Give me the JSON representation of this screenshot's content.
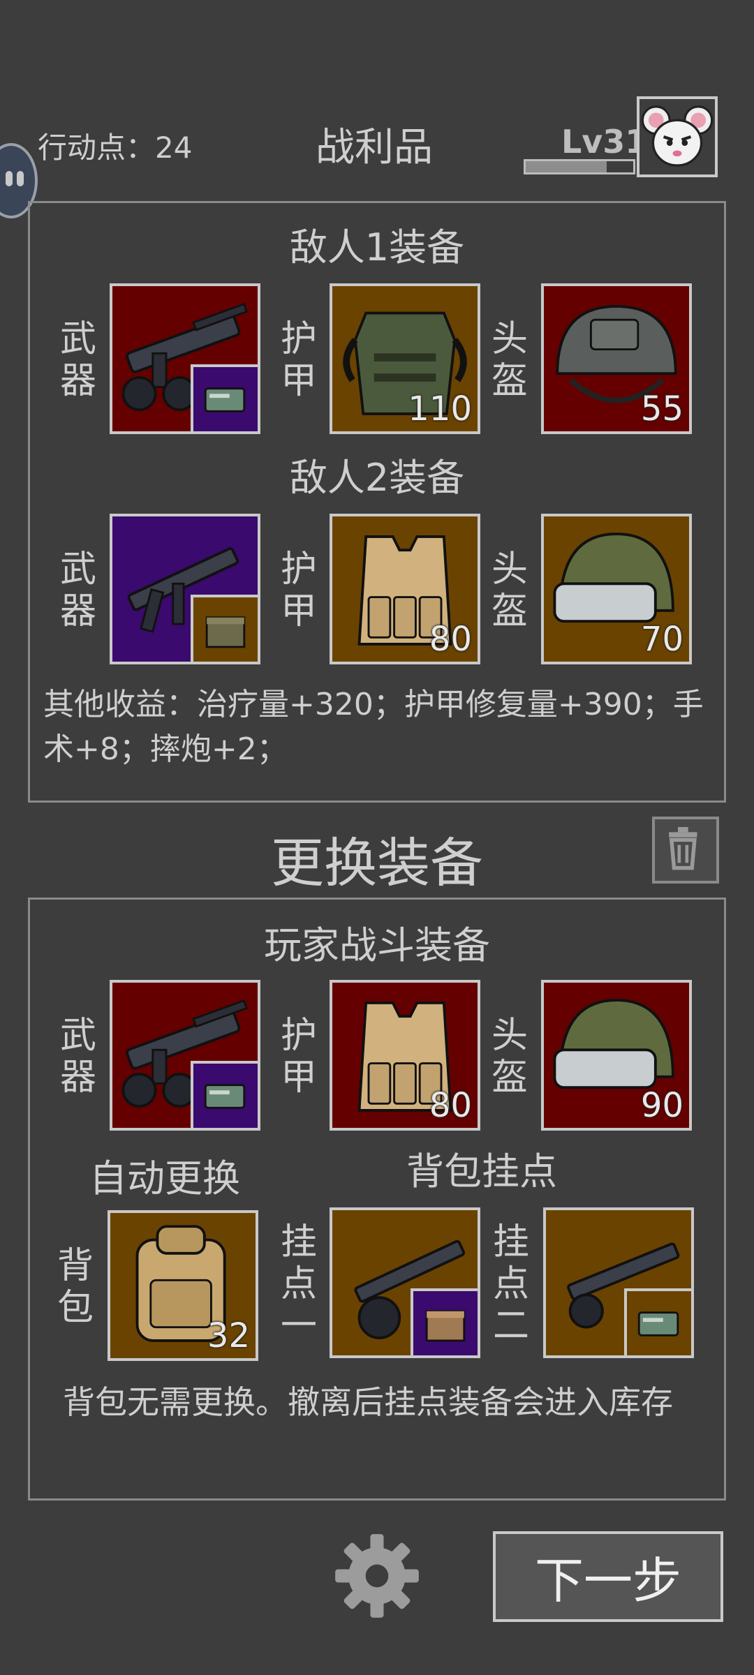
{
  "header": {
    "action_points_label": "行动点：24",
    "title": "战利品",
    "level": "Lv31",
    "level_progress": 0.75
  },
  "loot": {
    "enemy1": {
      "title": "敌人1装备",
      "weapon_label": "武器",
      "armor_label": "护甲",
      "helmet_label": "头盔",
      "armor_value": "110",
      "helmet_value": "55"
    },
    "enemy2": {
      "title": "敌人2装备",
      "weapon_label": "武器",
      "armor_label": "护甲",
      "helmet_label": "头盔",
      "armor_value": "80",
      "helmet_value": "70"
    },
    "other_income": "其他收益：治疗量+320；护甲修复量+390；手术+8；摔炮+2；"
  },
  "swap": {
    "title": "更换装备"
  },
  "player": {
    "title": "玩家战斗装备",
    "weapon_label": "武器",
    "armor_label": "护甲",
    "helmet_label": "头盔",
    "armor_value": "80",
    "helmet_value": "90",
    "auto_swap": "自动更换",
    "backpack_mounts": "背包挂点",
    "backpack_label": "背包",
    "backpack_value": "32",
    "mount1_label": "挂点一",
    "mount2_label": "挂点二",
    "note": "背包无需更换。撤离后挂点装备会进入库存"
  },
  "footer": {
    "next_button": "下一步"
  },
  "icons": {
    "settings": "gear-icon",
    "delete": "trash-icon",
    "avatar": "mouse-avatar-icon",
    "ammo": "ammo-box-icon",
    "supply": "supply-crate-icon"
  },
  "colors": {
    "background": "#3d3d3d",
    "slot_red": "#650000",
    "slot_brown": "#6b4300",
    "slot_purple": "#3a0a6e"
  }
}
